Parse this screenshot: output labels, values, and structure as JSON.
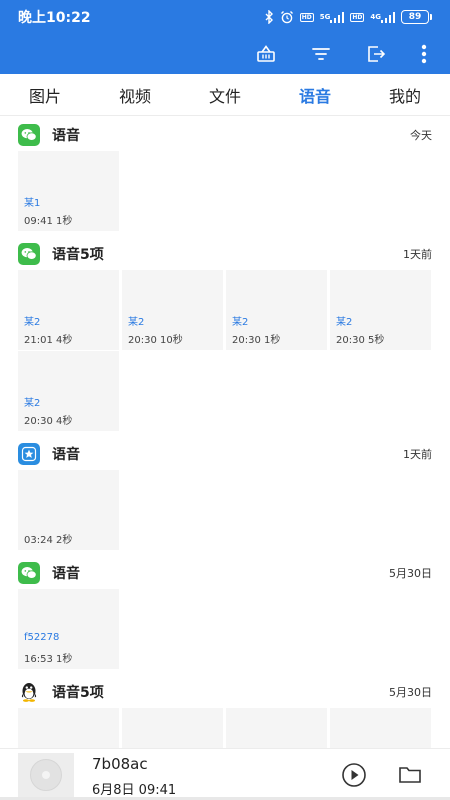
{
  "status": {
    "time": "晚上10:22",
    "hd": "HD",
    "sim1": "5G",
    "sim2": "4G",
    "battery": "89"
  },
  "tabs": [
    {
      "label": "图片",
      "active": false
    },
    {
      "label": "视频",
      "active": false
    },
    {
      "label": "文件",
      "active": false
    },
    {
      "label": "语音",
      "active": true
    },
    {
      "label": "我的",
      "active": false
    }
  ],
  "groups": [
    {
      "app": "wechat",
      "title": "语音",
      "time": "今天",
      "items": [
        {
          "name": "某1",
          "meta": "09:41  1秒"
        }
      ]
    },
    {
      "app": "wechat",
      "title": "语音5项",
      "time": "1天前",
      "items": [
        {
          "name": "某2",
          "meta": "21:01  4秒"
        },
        {
          "name": "某2",
          "meta": "20:30  10秒"
        },
        {
          "name": "某2",
          "meta": "20:30  1秒"
        },
        {
          "name": "某2",
          "meta": "20:30  5秒"
        },
        {
          "name": "某2",
          "meta": "20:30  4秒"
        }
      ]
    },
    {
      "app": "star",
      "title": "语音",
      "time": "1天前",
      "items": [
        {
          "name": "",
          "meta": "03:24  2秒"
        }
      ]
    },
    {
      "app": "wechat",
      "title": "语音",
      "time": "5月30日",
      "items": [
        {
          "name": "f52278",
          "meta": "16:53  1秒"
        }
      ]
    },
    {
      "app": "qq",
      "title": "语音5项",
      "time": "5月30日",
      "items": [
        {
          "name": "",
          "meta": ""
        },
        {
          "name": "",
          "meta": ""
        },
        {
          "name": "",
          "meta": ""
        },
        {
          "name": "",
          "meta": ""
        }
      ]
    }
  ],
  "player": {
    "title": "7b08ac",
    "datetime": "6月8日   09:41",
    "progress": 0.0
  },
  "colors": {
    "primary": "#2a7ae2",
    "wechat": "#3ebc4b",
    "card": "#f5f5f5"
  },
  "icons": {
    "toolbar": [
      "basket-icon",
      "filter-icon",
      "export-icon",
      "more-vert-icon"
    ],
    "player": [
      "play-icon",
      "folder-icon"
    ]
  }
}
